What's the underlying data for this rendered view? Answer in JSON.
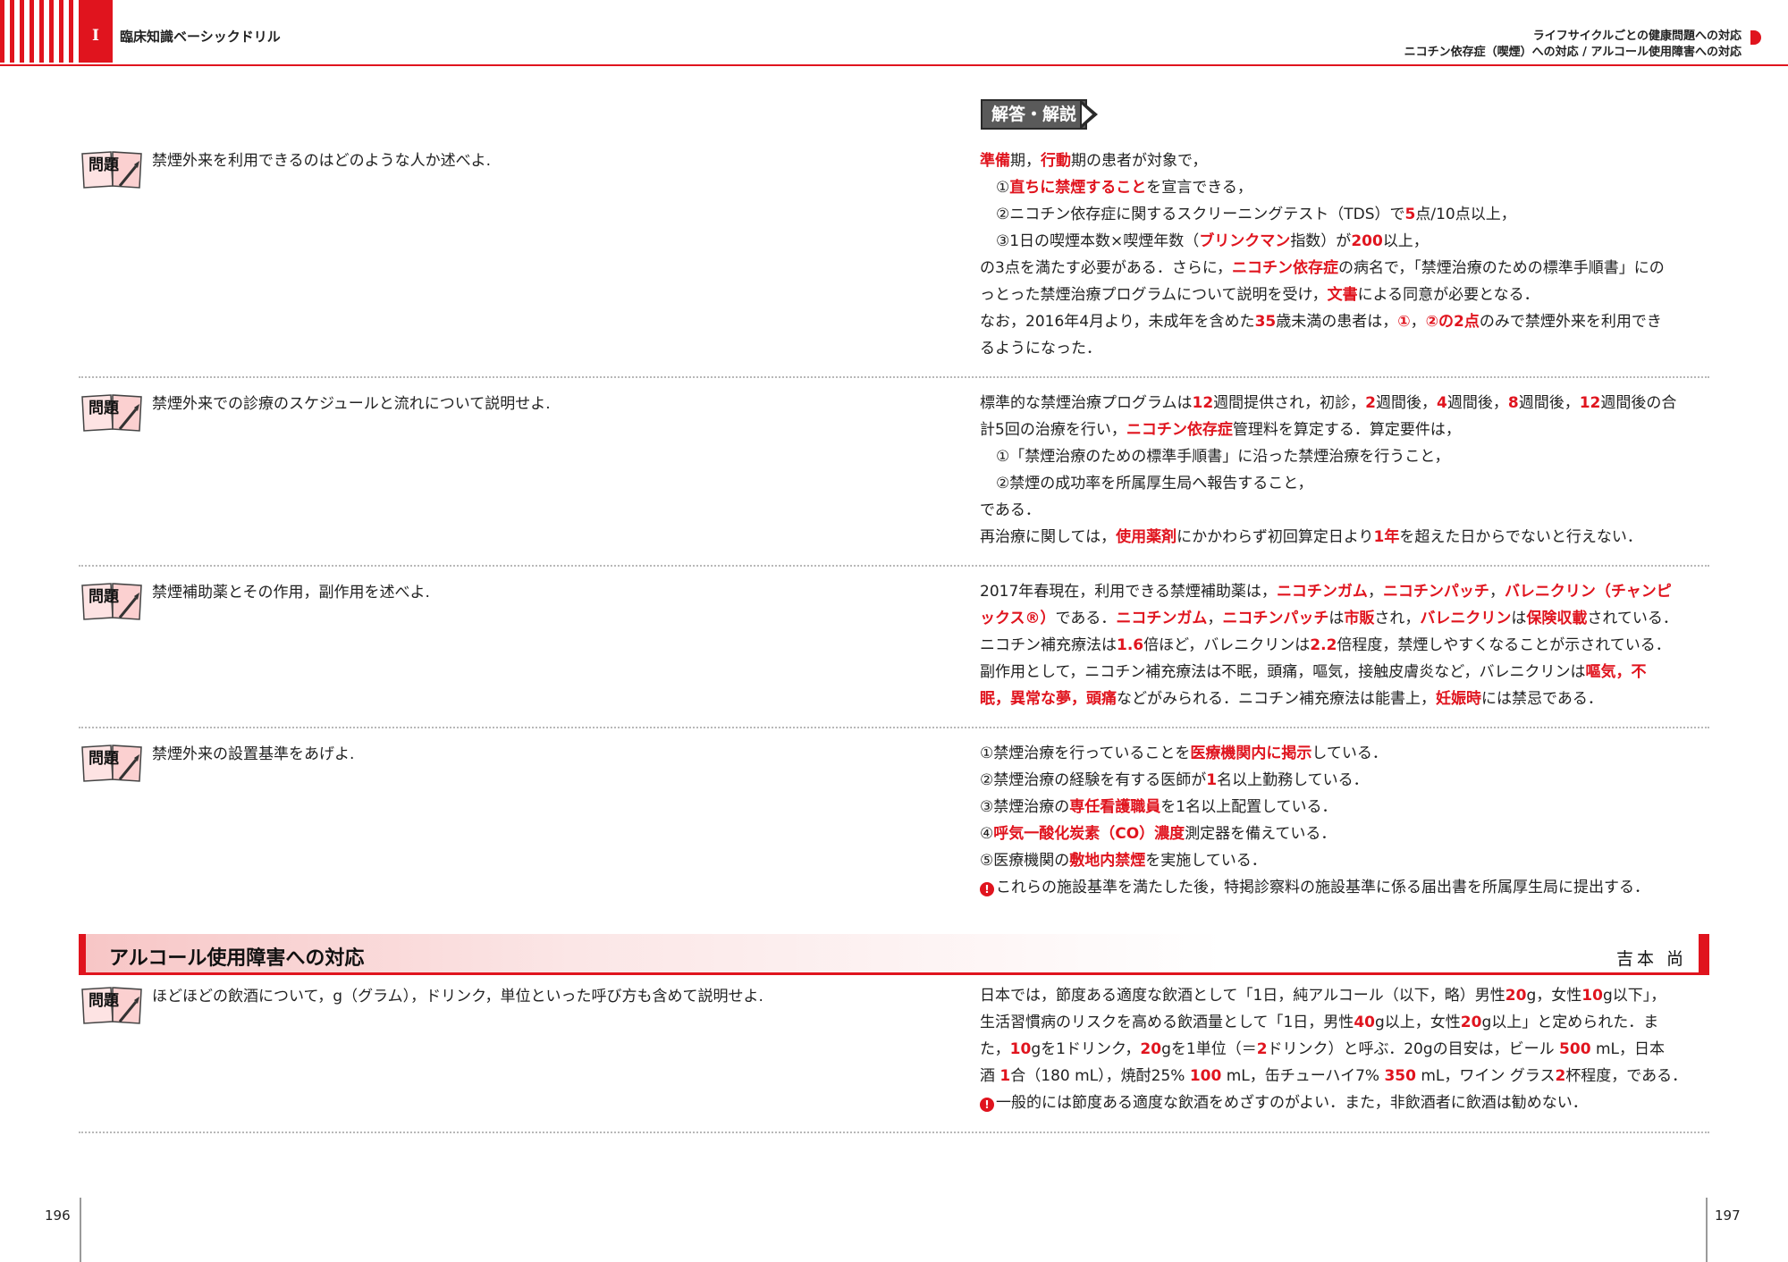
{
  "header": {
    "roman": "I",
    "book_title": "臨床知識ベーシックドリル",
    "topic_line1": "ライフサイクルごとの健康問題への対応",
    "topic_line2": "ニコチン依存症（喫煙）への対応 / アルコール使用障害への対応"
  },
  "answer_badge": "解答・解説",
  "question_icon_label": "問題",
  "questions": [
    {
      "text": "禁煙外来を利用できるのはどのような人か述べよ."
    },
    {
      "text": "禁煙外来での診療のスケジュールと流れについて説明せよ."
    },
    {
      "text": "禁煙補助薬とその作用，副作用を述べよ."
    },
    {
      "text": "禁煙外来の設置基準をあげよ."
    },
    {
      "text": "ほどほどの飲酒について，g（グラム），ドリンク，単位といった呼び方も含めて説明せよ."
    }
  ],
  "answers": [
    {
      "lines": [
        {
          "indent": false,
          "parts": [
            {
              "t": "準備",
              "r": true
            },
            {
              "t": "期，"
            },
            {
              "t": "行動",
              "r": true
            },
            {
              "t": "期の患者が対象で，"
            }
          ]
        },
        {
          "indent": true,
          "parts": [
            {
              "t": "①"
            },
            {
              "t": "直ちに禁煙すること",
              "r": true
            },
            {
              "t": "を宣言できる，"
            }
          ]
        },
        {
          "indent": true,
          "parts": [
            {
              "t": "②ニコチン依存症に関するスクリーニングテスト（TDS）で"
            },
            {
              "t": "5",
              "r": true
            },
            {
              "t": "点/10点以上，"
            }
          ]
        },
        {
          "indent": true,
          "parts": [
            {
              "t": "③1日の喫煙本数×喫煙年数（"
            },
            {
              "t": "ブリンクマン",
              "r": true
            },
            {
              "t": "指数）が"
            },
            {
              "t": "200",
              "r": true
            },
            {
              "t": "以上，"
            }
          ]
        },
        {
          "indent": false,
          "parts": [
            {
              "t": "の3点を満たす必要がある．さらに，"
            },
            {
              "t": "ニコチン依存症",
              "r": true
            },
            {
              "t": "の病名で，「禁煙治療のための標準手順書」にの"
            }
          ]
        },
        {
          "indent": false,
          "parts": [
            {
              "t": "っとった禁煙治療プログラムについて説明を受け，"
            },
            {
              "t": "文書",
              "r": true
            },
            {
              "t": "による同意が必要となる．"
            }
          ]
        },
        {
          "indent": false,
          "parts": [
            {
              "t": "なお，2016年4月より，未成年を含めた"
            },
            {
              "t": "35",
              "r": true
            },
            {
              "t": "歳未満の患者は，"
            },
            {
              "t": "①",
              "r": true
            },
            {
              "t": "，"
            },
            {
              "t": "②の2点",
              "r": true
            },
            {
              "t": "のみで禁煙外来を利用でき"
            }
          ]
        },
        {
          "indent": false,
          "parts": [
            {
              "t": "るようになった．"
            }
          ]
        }
      ]
    },
    {
      "lines": [
        {
          "indent": false,
          "parts": [
            {
              "t": "標準的な禁煙治療プログラムは"
            },
            {
              "t": "12",
              "r": true
            },
            {
              "t": "週間提供され，初診，"
            },
            {
              "t": "2",
              "r": true
            },
            {
              "t": "週間後，"
            },
            {
              "t": "4",
              "r": true
            },
            {
              "t": "週間後，"
            },
            {
              "t": "8",
              "r": true
            },
            {
              "t": "週間後，"
            },
            {
              "t": "12",
              "r": true
            },
            {
              "t": "週間後の合"
            }
          ]
        },
        {
          "indent": false,
          "parts": [
            {
              "t": "計5回の治療を行い，"
            },
            {
              "t": "ニコチン依存症",
              "r": true
            },
            {
              "t": "管理料を算定する．算定要件は，"
            }
          ]
        },
        {
          "indent": true,
          "parts": [
            {
              "t": "①「禁煙治療のための標準手順書」に沿った禁煙治療を行うこと，"
            }
          ]
        },
        {
          "indent": true,
          "parts": [
            {
              "t": "②禁煙の成功率を所属厚生局へ報告すること，"
            }
          ]
        },
        {
          "indent": false,
          "parts": [
            {
              "t": "である．"
            }
          ]
        },
        {
          "indent": false,
          "parts": [
            {
              "t": "再治療に関しては，"
            },
            {
              "t": "使用薬剤",
              "r": true
            },
            {
              "t": "にかかわらず初回算定日より"
            },
            {
              "t": "1年",
              "r": true
            },
            {
              "t": "を超えた日からでないと行えない．"
            }
          ]
        }
      ]
    },
    {
      "lines": [
        {
          "indent": false,
          "parts": [
            {
              "t": "2017年春現在，利用できる禁煙補助薬は，"
            },
            {
              "t": "ニコチンガム",
              "r": true
            },
            {
              "t": "，"
            },
            {
              "t": "ニコチンパッチ",
              "r": true
            },
            {
              "t": "，"
            },
            {
              "t": "バレニクリン（チャンピ",
              "r": true
            }
          ]
        },
        {
          "indent": false,
          "parts": [
            {
              "t": "ックス®）",
              "r": true
            },
            {
              "t": "である．"
            },
            {
              "t": "ニコチンガム",
              "r": true
            },
            {
              "t": "，"
            },
            {
              "t": "ニコチンパッチ",
              "r": true
            },
            {
              "t": "は"
            },
            {
              "t": "市販",
              "r": true
            },
            {
              "t": "され，"
            },
            {
              "t": "バレニクリン",
              "r": true
            },
            {
              "t": "は"
            },
            {
              "t": "保険収載",
              "r": true
            },
            {
              "t": "されている．"
            }
          ]
        },
        {
          "indent": false,
          "parts": [
            {
              "t": "ニコチン補充療法は"
            },
            {
              "t": "1.6",
              "r": true
            },
            {
              "t": "倍ほど，バレニクリンは"
            },
            {
              "t": "2.2",
              "r": true
            },
            {
              "t": "倍程度，禁煙しやすくなることが示されている．"
            }
          ]
        },
        {
          "indent": false,
          "parts": [
            {
              "t": "副作用として，ニコチン補充療法は不眠，頭痛，嘔気，接触皮膚炎など，バレニクリンは"
            },
            {
              "t": "嘔気，不",
              "r": true
            }
          ]
        },
        {
          "indent": false,
          "parts": [
            {
              "t": "眠，異常な夢，頭痛",
              "r": true
            },
            {
              "t": "などがみられる．ニコチン補充療法は能書上，"
            },
            {
              "t": "妊娠時",
              "r": true
            },
            {
              "t": "には禁忌である．"
            }
          ]
        }
      ]
    },
    {
      "lines": [
        {
          "indent": false,
          "parts": [
            {
              "t": "①禁煙治療を行っていることを"
            },
            {
              "t": "医療機関内に掲示",
              "r": true
            },
            {
              "t": "している．"
            }
          ]
        },
        {
          "indent": false,
          "parts": [
            {
              "t": "②禁煙治療の経験を有する医師が"
            },
            {
              "t": "1",
              "r": true
            },
            {
              "t": "名以上勤務している．"
            }
          ]
        },
        {
          "indent": false,
          "parts": [
            {
              "t": "③禁煙治療の"
            },
            {
              "t": "専任看護職員",
              "r": true
            },
            {
              "t": "を1名以上配置している．"
            }
          ]
        },
        {
          "indent": false,
          "parts": [
            {
              "t": "④"
            },
            {
              "t": "呼気一酸化炭素（CO）濃度",
              "r": true
            },
            {
              "t": "測定器を備えている．"
            }
          ]
        },
        {
          "indent": false,
          "parts": [
            {
              "t": "⑤医療機関の"
            },
            {
              "t": "敷地内禁煙",
              "r": true
            },
            {
              "t": "を実施している．"
            }
          ]
        },
        {
          "indent": false,
          "warn": true,
          "parts": [
            {
              "t": "これらの施設基準を満たした後，特掲診察料の施設基準に係る届出書を所属厚生局に提出する．"
            }
          ]
        }
      ]
    },
    {
      "lines": [
        {
          "indent": false,
          "parts": [
            {
              "t": "日本では，節度ある適度な飲酒として「1日，純アルコール（以下，略）男性"
            },
            {
              "t": "20",
              "r": true
            },
            {
              "t": "g，女性"
            },
            {
              "t": "10",
              "r": true
            },
            {
              "t": "g以下」，"
            }
          ]
        },
        {
          "indent": false,
          "parts": [
            {
              "t": "生活習慣病のリスクを高める飲酒量として「1日，男性"
            },
            {
              "t": "40",
              "r": true
            },
            {
              "t": "g以上，女性"
            },
            {
              "t": "20",
              "r": true
            },
            {
              "t": "g以上」と定められた．ま"
            }
          ]
        },
        {
          "indent": false,
          "parts": [
            {
              "t": "た，"
            },
            {
              "t": "10",
              "r": true
            },
            {
              "t": "gを1ドリンク，"
            },
            {
              "t": "20",
              "r": true
            },
            {
              "t": "gを1単位（＝"
            },
            {
              "t": "2",
              "r": true
            },
            {
              "t": "ドリンク）と呼ぶ．20gの目安は，ビール "
            },
            {
              "t": "500",
              "r": true
            },
            {
              "t": " mL，日本"
            }
          ]
        },
        {
          "indent": false,
          "parts": [
            {
              "t": "酒 "
            },
            {
              "t": "1",
              "r": true
            },
            {
              "t": "合（180 mL），焼酎25% "
            },
            {
              "t": "100",
              "r": true
            },
            {
              "t": " mL，缶チューハイ7% "
            },
            {
              "t": "350",
              "r": true
            },
            {
              "t": " mL，ワイン グラス"
            },
            {
              "t": "2",
              "r": true
            },
            {
              "t": "杯程度，である．"
            }
          ]
        },
        {
          "indent": false,
          "warn": true,
          "parts": [
            {
              "t": "一般的には節度ある適度な飲酒をめざすのがよい．また，非飲酒者に飲酒は勧めない．"
            }
          ]
        }
      ]
    }
  ],
  "section": {
    "title": "アルコール使用障害への対応",
    "author": "吉本 尚"
  },
  "page_numbers": {
    "left": "196",
    "right": "197"
  },
  "colors": {
    "accent": "#e0141e",
    "text": "#222222",
    "badge": "#5a5a5a"
  }
}
